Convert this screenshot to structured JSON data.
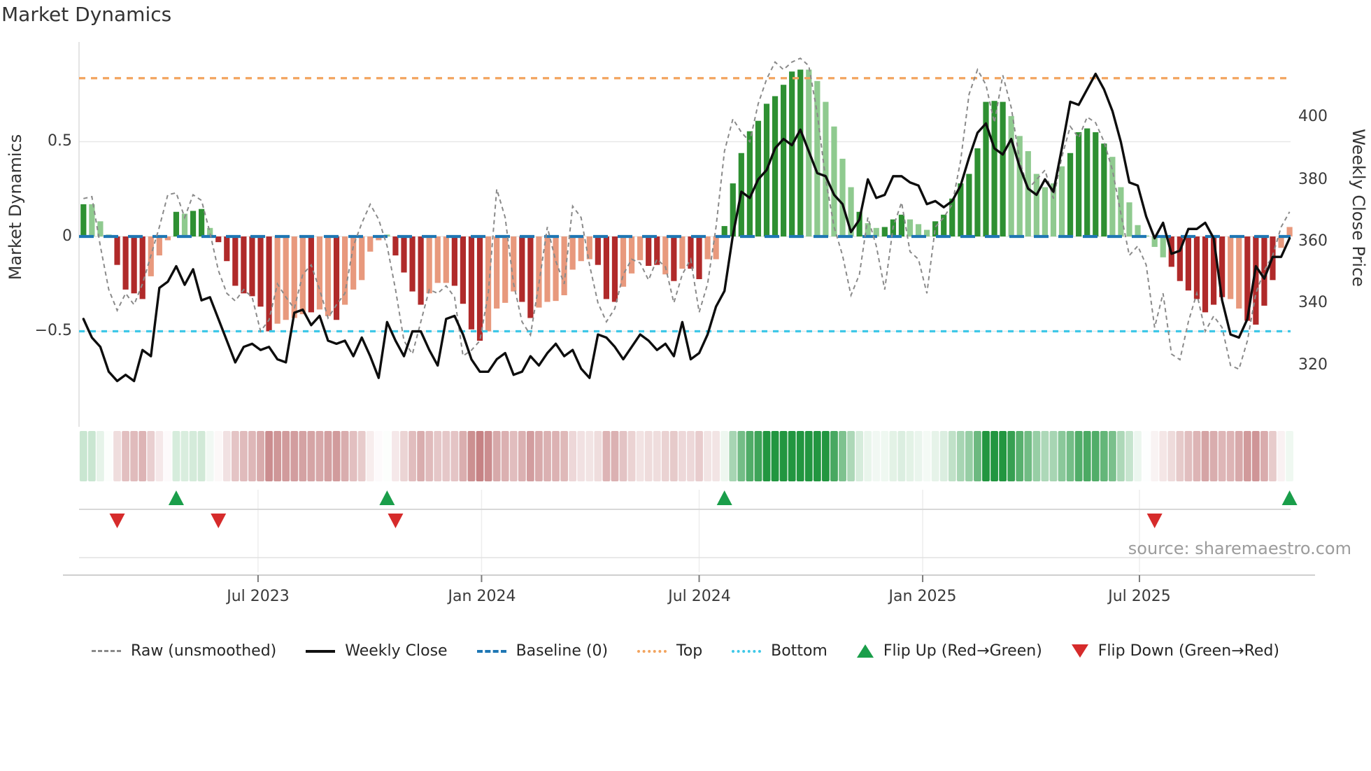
{
  "title": "Market Dynamics",
  "axes": {
    "left_label": "Market Dynamics",
    "right_label": "Weekly Close Price",
    "left_ticks": [
      "0.5",
      "0",
      "−0.5"
    ],
    "right_ticks": [
      "400",
      "380",
      "360",
      "340",
      "320"
    ],
    "x_ticks": [
      "Jul 2023",
      "Jan 2024",
      "Jul 2024",
      "Jan 2025",
      "Jul 2025"
    ]
  },
  "source": "source: sharemaestro.com",
  "legend": {
    "items": [
      {
        "label": "Raw (unsmoothed)"
      },
      {
        "label": "Weekly Close"
      },
      {
        "label": "Baseline (0)"
      },
      {
        "label": "Top"
      },
      {
        "label": "Bottom"
      },
      {
        "label": "Flip Up (Red→Green)"
      },
      {
        "label": "Flip Down (Green→Red)"
      }
    ]
  },
  "colors": {
    "bar_dark_green": "#2e9032",
    "bar_light_green": "#8fca8f",
    "bar_dark_red": "#b02a2a",
    "bar_salmon": "#e8997d",
    "baseline_blue": "#1f77b4",
    "top_orange": "#f2a45f",
    "bottom_cyan": "#3fc8e8",
    "raw_gray": "#8a8a8a",
    "close_black": "#0d0d0d",
    "flip_up_green": "#1a9e4a",
    "flip_down_red": "#d62b2b",
    "heat_green_max": "#229640",
    "heat_red_max": "#b66062",
    "grid": "#e8e8e8",
    "spine": "#dcdcdc"
  },
  "chart_data": {
    "type": "combo (weekly oscillator bars + raw line + price line + heat strip + flip markers)",
    "title": "Market Dynamics",
    "xlabel": "",
    "ylabel_left": "Market Dynamics",
    "ylabel_right": "Weekly Close Price",
    "weeks": 144,
    "x_tick_labels": [
      "Jul 2023",
      "Jan 2024",
      "Jul 2024",
      "Jan 2025",
      "Jul 2025"
    ],
    "x_tick_weeks": [
      20.7,
      47.2,
      73.0,
      99.5,
      125.2
    ],
    "ylim_left": [
      -1.0,
      1.03
    ],
    "ylim_right_approx": [
      300,
      424
    ],
    "baseline": 0,
    "top": 0.835,
    "bottom": -0.5,
    "legend_position": "bottom",
    "grid": "horizontal at 0.5, 0, -0.5",
    "oscillator": {
      "tones_key": "g=dark green, G=light green, r=dark red, R=salmon",
      "tones": "gGGGrrrrRRRgGggGrrrrrrrRRRRrRRrRRRRRGrrrrRRRrrrrRRRRrrRRRRRRRrrrRRRrrRrRrrRRggggggggggGGGGGGgGGgggGGGgggggggggGGGGGGGgggggGGGGGGGrrrrrrrRRrrrrRRRg",
      "values": [
        0.17,
        0.17,
        0.08,
        0.01,
        -0.15,
        -0.28,
        -0.3,
        -0.33,
        -0.21,
        -0.1,
        -0.02,
        0.13,
        0.12,
        0.135,
        0.145,
        0.045,
        -0.03,
        -0.13,
        -0.26,
        -0.3,
        -0.315,
        -0.37,
        -0.5,
        -0.46,
        -0.44,
        -0.43,
        -0.41,
        -0.4,
        -0.385,
        -0.42,
        -0.44,
        -0.36,
        -0.28,
        -0.23,
        -0.08,
        -0.02,
        0.01,
        -0.1,
        -0.19,
        -0.29,
        -0.36,
        -0.3,
        -0.245,
        -0.245,
        -0.26,
        -0.355,
        -0.49,
        -0.55,
        -0.5,
        -0.38,
        -0.35,
        -0.29,
        -0.345,
        -0.43,
        -0.375,
        -0.345,
        -0.34,
        -0.31,
        -0.175,
        -0.13,
        -0.12,
        -0.15,
        -0.33,
        -0.345,
        -0.265,
        -0.195,
        -0.125,
        -0.155,
        -0.15,
        -0.2,
        -0.235,
        -0.17,
        -0.17,
        -0.225,
        -0.12,
        -0.12,
        0.055,
        0.28,
        0.44,
        0.555,
        0.61,
        0.7,
        0.74,
        0.8,
        0.87,
        0.88,
        0.88,
        0.82,
        0.71,
        0.58,
        0.41,
        0.26,
        0.13,
        0.07,
        0.045,
        0.05,
        0.09,
        0.115,
        0.09,
        0.065,
        0.035,
        0.08,
        0.115,
        0.2,
        0.28,
        0.33,
        0.465,
        0.71,
        0.715,
        0.71,
        0.635,
        0.53,
        0.45,
        0.33,
        0.26,
        0.28,
        0.37,
        0.44,
        0.55,
        0.57,
        0.55,
        0.49,
        0.42,
        0.26,
        0.18,
        0.06,
        0.005,
        -0.055,
        -0.11,
        -0.16,
        -0.235,
        -0.285,
        -0.33,
        -0.4,
        -0.36,
        -0.32,
        -0.33,
        -0.38,
        -0.445,
        -0.465,
        -0.365,
        -0.23,
        -0.06,
        0.05
      ]
    },
    "raw_unsmoothed": [
      0.2,
      0.21,
      -0.05,
      -0.28,
      -0.39,
      -0.3,
      -0.36,
      -0.25,
      -0.1,
      0.05,
      0.22,
      0.23,
      0.1,
      0.22,
      0.19,
      0.02,
      -0.18,
      -0.3,
      -0.34,
      -0.28,
      -0.32,
      -0.5,
      -0.44,
      -0.25,
      -0.32,
      -0.38,
      -0.2,
      -0.15,
      -0.28,
      -0.43,
      -0.36,
      -0.3,
      -0.05,
      0.07,
      0.17,
      0.09,
      -0.05,
      -0.28,
      -0.55,
      -0.62,
      -0.45,
      -0.28,
      -0.3,
      -0.26,
      -0.32,
      -0.63,
      -0.6,
      -0.55,
      -0.3,
      0.25,
      0.1,
      -0.25,
      -0.45,
      -0.52,
      -0.25,
      0.05,
      -0.13,
      -0.25,
      0.16,
      0.1,
      -0.15,
      -0.35,
      -0.45,
      -0.38,
      -0.2,
      -0.12,
      -0.14,
      -0.23,
      -0.12,
      -0.16,
      -0.35,
      -0.2,
      -0.12,
      -0.4,
      -0.25,
      0.05,
      0.45,
      0.62,
      0.55,
      0.5,
      0.7,
      0.83,
      0.92,
      0.88,
      0.92,
      0.94,
      0.9,
      0.65,
      0.3,
      0.05,
      -0.1,
      -0.31,
      -0.2,
      0.1,
      -0.05,
      -0.28,
      0.05,
      0.18,
      -0.08,
      -0.12,
      -0.3,
      0.05,
      0.1,
      0.17,
      0.4,
      0.75,
      0.88,
      0.8,
      0.6,
      0.85,
      0.68,
      0.4,
      0.25,
      0.3,
      0.35,
      0.2,
      0.42,
      0.58,
      0.52,
      0.63,
      0.6,
      0.5,
      0.35,
      0.12,
      -0.1,
      -0.05,
      -0.15,
      -0.48,
      -0.3,
      -0.62,
      -0.65,
      -0.45,
      -0.3,
      -0.5,
      -0.42,
      -0.48,
      -0.68,
      -0.7,
      -0.55,
      -0.3,
      -0.18,
      -0.1,
      0.05,
      0.13
    ],
    "weekly_close": [
      335,
      329,
      326,
      318,
      315,
      317,
      315,
      325,
      323,
      345,
      347,
      352,
      346,
      351,
      341,
      342,
      335,
      328,
      321,
      326,
      327,
      325,
      326,
      322,
      321,
      337,
      338,
      333,
      336,
      328,
      327,
      328,
      323,
      329,
      323,
      316,
      334,
      328,
      323,
      331,
      331,
      325,
      320,
      335,
      336,
      330,
      322,
      318,
      318,
      322,
      324,
      317,
      318,
      323,
      320,
      324,
      327,
      323,
      325,
      319,
      316,
      330,
      329,
      326,
      322,
      326,
      330,
      328,
      325,
      327,
      323,
      334,
      322,
      324,
      330,
      339,
      344,
      362,
      376,
      374,
      380,
      383,
      390,
      393,
      391,
      396,
      389,
      382,
      381,
      375,
      372,
      363,
      367,
      380,
      374,
      375,
      381,
      381,
      379,
      378,
      372,
      373,
      371,
      373,
      378,
      387,
      395,
      398,
      390,
      388,
      393,
      384,
      377,
      375,
      380,
      376,
      390,
      405,
      404,
      409,
      414,
      409,
      402,
      392,
      379,
      378,
      368,
      361,
      366,
      356,
      357,
      364,
      364,
      366,
      361,
      341,
      330,
      329,
      335,
      352,
      348,
      355,
      355,
      361
    ],
    "heat_strip": "per-week color: green if oscillator>0 else red, intensity proportional to |value|",
    "flip_up_weeks": [
      11,
      36,
      76,
      143
    ],
    "flip_down_weeks": [
      4,
      16,
      37,
      127
    ]
  }
}
